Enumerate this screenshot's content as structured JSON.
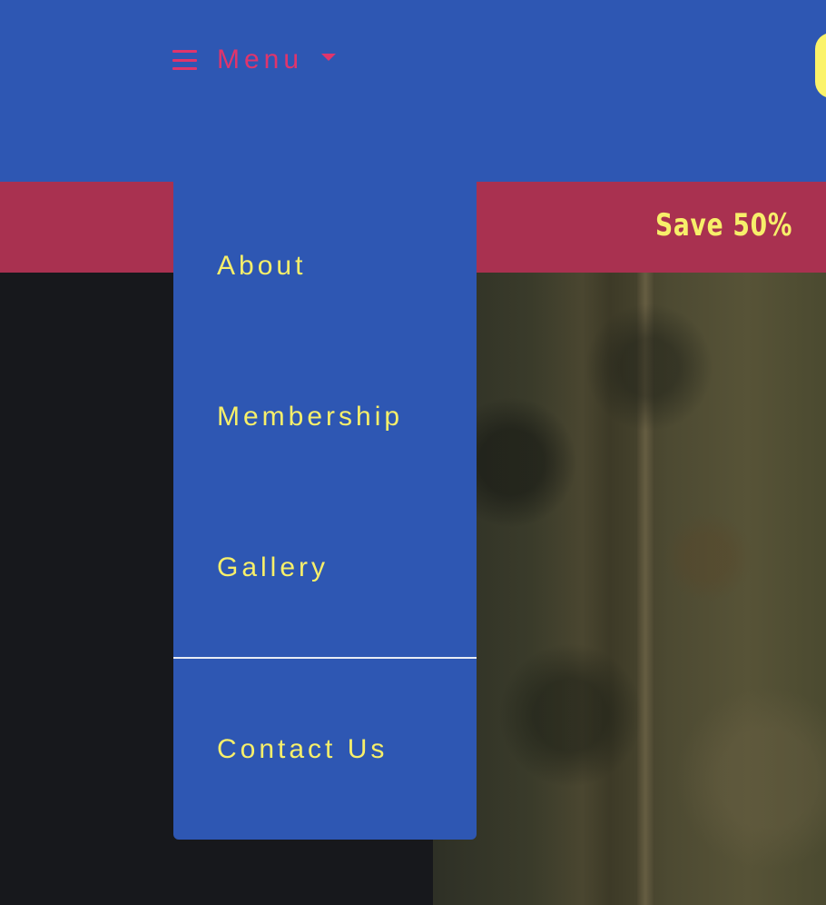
{
  "header": {
    "menu_label": "Menu"
  },
  "promo": {
    "text": "Save 50%"
  },
  "dropdown": {
    "items": [
      {
        "label": "About"
      },
      {
        "label": "Membership"
      },
      {
        "label": "Gallery"
      },
      {
        "label": "Contact Us"
      }
    ]
  },
  "icons": {
    "menu": "hamburger-icon",
    "dropdown": "caret-down-icon"
  },
  "colors": {
    "header_bg": "#2e57b3",
    "menu_accent": "#e0356c",
    "promo_bg": "#a93150",
    "highlight_text": "#f7ef6a",
    "page_bg": "#17181c"
  }
}
